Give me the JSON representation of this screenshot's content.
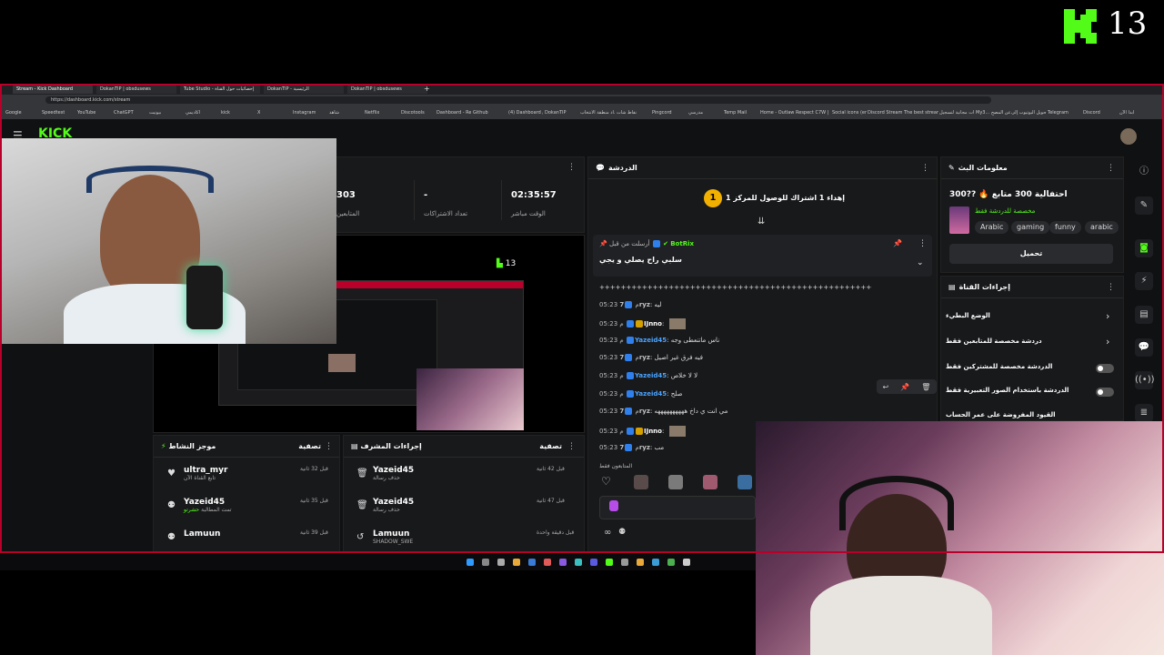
{
  "overlay": {
    "logo_number": "13"
  },
  "browser": {
    "tabs": [
      "Stream - Kick Dashboard",
      "DokanTIP | obsdusews",
      "Tube Studio - إحصائيات حول القناة",
      "DokanTIP - الرئيسية",
      "DokanTIP | obsdusews"
    ],
    "url": "https://dashboard.kick.com/stream",
    "bookmarks": [
      "Google",
      "Speedtest",
      "YouTube",
      "ChatGPT",
      "بيونيت",
      "أكاديمي",
      "kick",
      "X",
      "Instagram",
      "شاهد",
      "Netflix",
      "Discotools",
      "Dashboard - Restrea...",
      "Github",
      "(4) Dashboard / Stre...",
      "DokanTIP",
      "إعداد منطقة الانتخاب...",
      "نقاط شات",
      "Pingcord",
      "مدرسي",
      "Temp Mail",
      "Home - Outlaw",
      "Respect C7W | ...",
      "Social icons (emoji)",
      "Discord StreamKit O...",
      "The best streaming...",
      "بيانات مجانية لتسجيل",
      "My3... عن المصح MP3",
      "تحويل اليوتيوب إلى",
      "Telegram",
      "Discord",
      "ابدأ الآن"
    ]
  },
  "dashboard": {
    "brand": "KICK",
    "stats": {
      "followers_value": "303",
      "followers_label": "المتابعين",
      "subs_value": "-",
      "subs_label": "تعداد الاشتراكات",
      "live_value": "02:35:57",
      "live_label": "الوقت مباشر"
    },
    "chat": {
      "title": "الدردشة",
      "goal_text": "إهداء 1 اشتراك للوصول للمركز 1",
      "goal_rank": "1",
      "pinned_by_label": "أرسلت من قبل",
      "pinned_user": "BotRix",
      "pinned_message": "سلبي راح يصلي و يجي",
      "messages": [
        {
          "time": "",
          "user": "",
          "text": "++++++++++++++++++++++++++++++++++++++++++++++++++++++++++++++"
        },
        {
          "time": "05:23 م",
          "user": "7ryz",
          "text": "ليه",
          "color": "#c0c0c0"
        },
        {
          "time": "05:23 م",
          "user": "IJnno",
          "text": "",
          "color": "#ffffff"
        },
        {
          "time": "05:23 م",
          "user": "Yazeid45",
          "text": "ناس ماتنعطى وجه",
          "color": "#4aa3ff"
        },
        {
          "time": "05:23 م",
          "user": "7ryz",
          "text": "فيه فرق غير اصيل",
          "color": "#c0c0c0"
        },
        {
          "time": "05:23 م",
          "user": "Yazeid45",
          "text": "لا لا خلاص",
          "color": "#4aa3ff"
        },
        {
          "time": "05:23 م",
          "user": "Yazeid45",
          "text": "صلح",
          "color": "#4aa3ff"
        },
        {
          "time": "05:23 م",
          "user": "7ryz",
          "text": "مي انت ي داخ ههههههههههه",
          "color": "#c0c0c0"
        },
        {
          "time": "05:23 م",
          "user": "IJnno",
          "text": "",
          "color": "#ffffff"
        },
        {
          "time": "05:23 م",
          "user": "7ryz",
          "text": "مب",
          "color": "#c0c0c0"
        }
      ],
      "followers_only_label": "المتابعون فقط"
    },
    "stream_info": {
      "title": "معلومات البث",
      "stream_title": "احتفالية 300 متابع 🔥 ??300",
      "category": "مخصصة للدردشة فقط",
      "tags": [
        "arabic",
        "funny",
        "gaming",
        "Arabic"
      ],
      "edit_button": "تحميل"
    },
    "channel_actions": {
      "title": "إجراءات القناة",
      "items": [
        {
          "label": "الوضع البطيء",
          "control": "arrow"
        },
        {
          "label": "دردشة مخصصة للمتابعين فقط",
          "control": "arrow"
        },
        {
          "label": "الدردشة مخصصة للمشتركين فقط",
          "control": "toggle"
        },
        {
          "label": "الدردشة باستخدام الصور التعبيرية فقط",
          "control": "toggle"
        },
        {
          "label": "القيود المفروضة على عمر الحساب",
          "control": "arrow"
        }
      ]
    },
    "activity": {
      "title": "موجز النشاط",
      "filter_label": "تصفية",
      "rows": [
        {
          "user": "ultra_myr",
          "sub": "تابع القناة الآن",
          "time": "قبل 32 ثانية"
        },
        {
          "user": "Yazeid45",
          "sub": "تمت المطالبة",
          "highlight": "حشرتو",
          "time": "قبل 35 ثانية"
        },
        {
          "user": "Lamuun",
          "sub": "",
          "time": "قبل 39 ثانية"
        }
      ]
    },
    "mod_actions": {
      "title": "إجراءات المشرف",
      "filter_label": "تصفية",
      "rows": [
        {
          "user": "Yazeid45",
          "sub": "حذف رسالة",
          "time": "قبل 42 ثانية"
        },
        {
          "user": "Yazeid45",
          "sub": "حذف رسالة",
          "time": "قبل 47 ثانية"
        },
        {
          "user": "Lamuun",
          "sub": "SHADOW_SWE",
          "time": "قبل دقيقة واحدة"
        }
      ]
    },
    "preview": {
      "logo_number": "13"
    }
  },
  "colors": {
    "kick_green": "#53fc18",
    "frame_red": "#b8002a",
    "panel_bg": "#18191b"
  }
}
